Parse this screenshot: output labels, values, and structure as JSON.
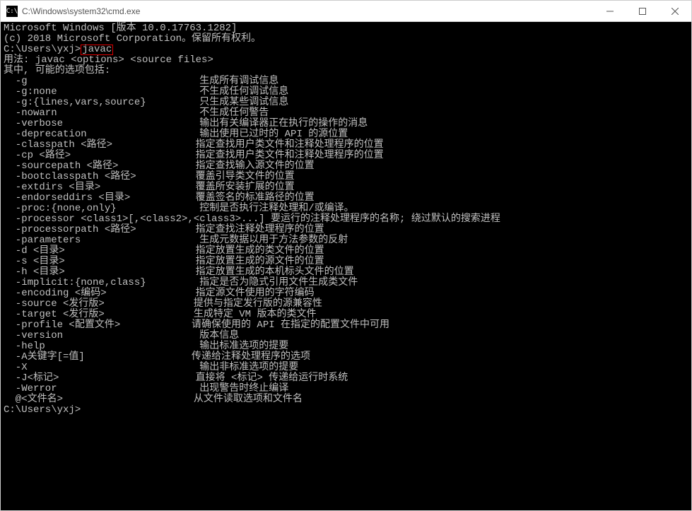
{
  "window": {
    "title": "C:\\Windows\\system32\\cmd.exe",
    "icon_text": "C:\\"
  },
  "terminal": {
    "banner_line1": "Microsoft Windows [版本 10.0.17763.1282]",
    "banner_line2": "(c) 2018 Microsoft Corporation。保留所有权利。",
    "prompt1_prefix": "C:\\Users\\yxj>",
    "prompt1_cmd": "javac",
    "usage_line": "用法: javac <options> <source files>",
    "options_header": "其中, 可能的选项包括:",
    "options": [
      {
        "flag": "  -g",
        "desc": "生成所有调试信息"
      },
      {
        "flag": "  -g:none",
        "desc": "不生成任何调试信息"
      },
      {
        "flag": "  -g:{lines,vars,source}",
        "desc": "只生成某些调试信息"
      },
      {
        "flag": "  -nowarn",
        "desc": "不生成任何警告"
      },
      {
        "flag": "  -verbose",
        "desc": "输出有关编译器正在执行的操作的消息"
      },
      {
        "flag": "  -deprecation",
        "desc": "输出使用已过时的 API 的源位置"
      },
      {
        "flag": "  -classpath <路径>",
        "desc": "指定查找用户类文件和注释处理程序的位置"
      },
      {
        "flag": "  -cp <路径>",
        "desc": "指定查找用户类文件和注释处理程序的位置"
      },
      {
        "flag": "  -sourcepath <路径>",
        "desc": "指定查找输入源文件的位置"
      },
      {
        "flag": "  -bootclasspath <路径>",
        "desc": "覆盖引导类文件的位置"
      },
      {
        "flag": "  -extdirs <目录>",
        "desc": "覆盖所安装扩展的位置"
      },
      {
        "flag": "  -endorseddirs <目录>",
        "desc": "覆盖签名的标准路径的位置"
      },
      {
        "flag": "  -proc:{none,only}",
        "desc": "控制是否执行注释处理和/或编译。"
      },
      {
        "flag": "  -processor <class1>[,<class2>,<class3>...]",
        "desc": "要运行的注释处理程序的名称; 绕过默认的搜索进程"
      },
      {
        "flag": "  -processorpath <路径>",
        "desc": "指定查找注释处理程序的位置"
      },
      {
        "flag": "  -parameters",
        "desc": "生成元数据以用于方法参数的反射"
      },
      {
        "flag": "  -d <目录>",
        "desc": "指定放置生成的类文件的位置"
      },
      {
        "flag": "  -s <目录>",
        "desc": "指定放置生成的源文件的位置"
      },
      {
        "flag": "  -h <目录>",
        "desc": "指定放置生成的本机标头文件的位置"
      },
      {
        "flag": "  -implicit:{none,class}",
        "desc": "指定是否为隐式引用文件生成类文件"
      },
      {
        "flag": "  -encoding <编码>",
        "desc": "指定源文件使用的字符编码"
      },
      {
        "flag": "  -source <发行版>",
        "desc": "提供与指定发行版的源兼容性"
      },
      {
        "flag": "  -target <发行版>",
        "desc": "生成特定 VM 版本的类文件"
      },
      {
        "flag": "  -profile <配置文件>",
        "desc": "请确保使用的 API 在指定的配置文件中可用"
      },
      {
        "flag": "  -version",
        "desc": "版本信息"
      },
      {
        "flag": "  -help",
        "desc": "输出标准选项的提要"
      },
      {
        "flag": "  -A关键字[=值]",
        "desc": "传递给注释处理程序的选项"
      },
      {
        "flag": "  -X",
        "desc": "输出非标准选项的提要"
      },
      {
        "flag": "  -J<标记>",
        "desc": "直接将 <标记> 传递给运行时系统"
      },
      {
        "flag": "  -Werror",
        "desc": "出现警告时终止编译"
      },
      {
        "flag": "  @<文件名>",
        "desc": "从文件读取选项和文件名"
      }
    ],
    "prompt2": "C:\\Users\\yxj>",
    "col1_width": 33
  }
}
